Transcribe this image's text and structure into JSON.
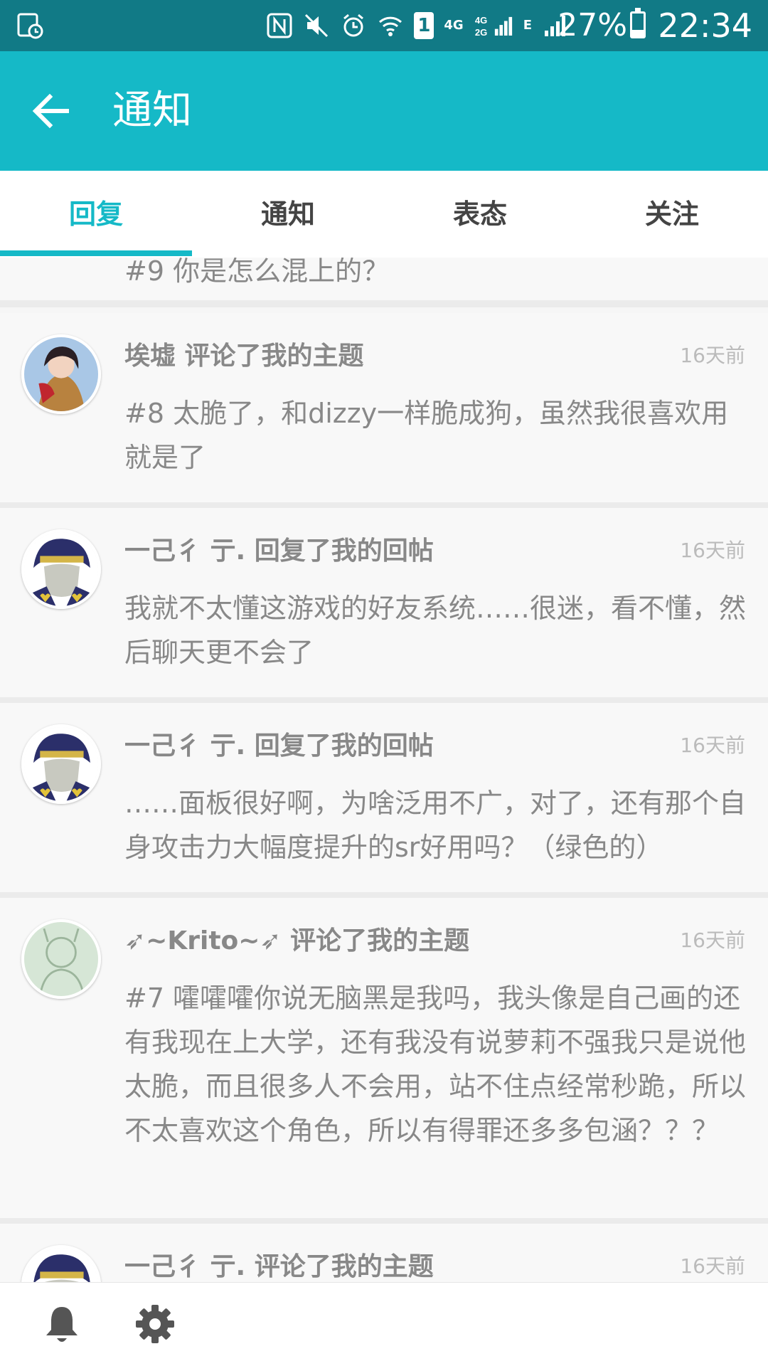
{
  "status_bar": {
    "carrier_1": "4G",
    "carrier_2": "4G 2G",
    "carrier_3": "E",
    "sim_slot": "1",
    "battery": "27%",
    "battery_level": 0.27,
    "time": "22:34"
  },
  "app_bar": {
    "title": "通知"
  },
  "tabs": [
    {
      "label": "回复",
      "active": true
    },
    {
      "label": "通知",
      "active": false
    },
    {
      "label": "表态",
      "active": false
    },
    {
      "label": "关注",
      "active": false
    }
  ],
  "items": [
    {
      "title": "",
      "time": "",
      "body": "#9 你是怎么混上的？",
      "avatar": "green-avatar"
    },
    {
      "title": "埃墟 评论了我的主题",
      "time": "16天前",
      "body": "#8 太脆了，和dizzy一样脆成狗，虽然我很喜欢用就是了",
      "avatar": "anime-girl-avatar"
    },
    {
      "title": "一己彳 亍. 回复了我的回帖",
      "time": "16天前",
      "body": "我就不太懂这游戏的好友系统……很迷，看不懂，然后聊天更不会了",
      "avatar": "josuke-avatar"
    },
    {
      "title": "一己彳 亍. 回复了我的回帖",
      "time": "16天前",
      "body": "……面板很好啊，为啥泛用不广，对了，还有那个自身攻击力大幅度提升的sr好用吗？（绿色的）",
      "avatar": "josuke-avatar"
    },
    {
      "title": "➶~Krito~➶ 评论了我的主题",
      "time": "16天前",
      "body": "#7 嚯嚯嚯你说无脑黑是我吗，我头像是自己画的还有我现在上大学，还有我没有说萝莉不强我只是说他太脆，而且很多人不会用，站不住点经常秒跪，所以不太喜欢这个角色，所以有得罪还多多包涵？？？",
      "avatar": "sketch-avatar"
    },
    {
      "title": "一己彳 亍. 评论了我的主题",
      "time": "16天前",
      "body": "",
      "avatar": "josuke-avatar"
    }
  ],
  "bottom_bar": {
    "icons": [
      "bell-icon",
      "gear-icon"
    ]
  },
  "colors": {
    "accent": "#15b9c7",
    "status_bar": "#117a86"
  }
}
